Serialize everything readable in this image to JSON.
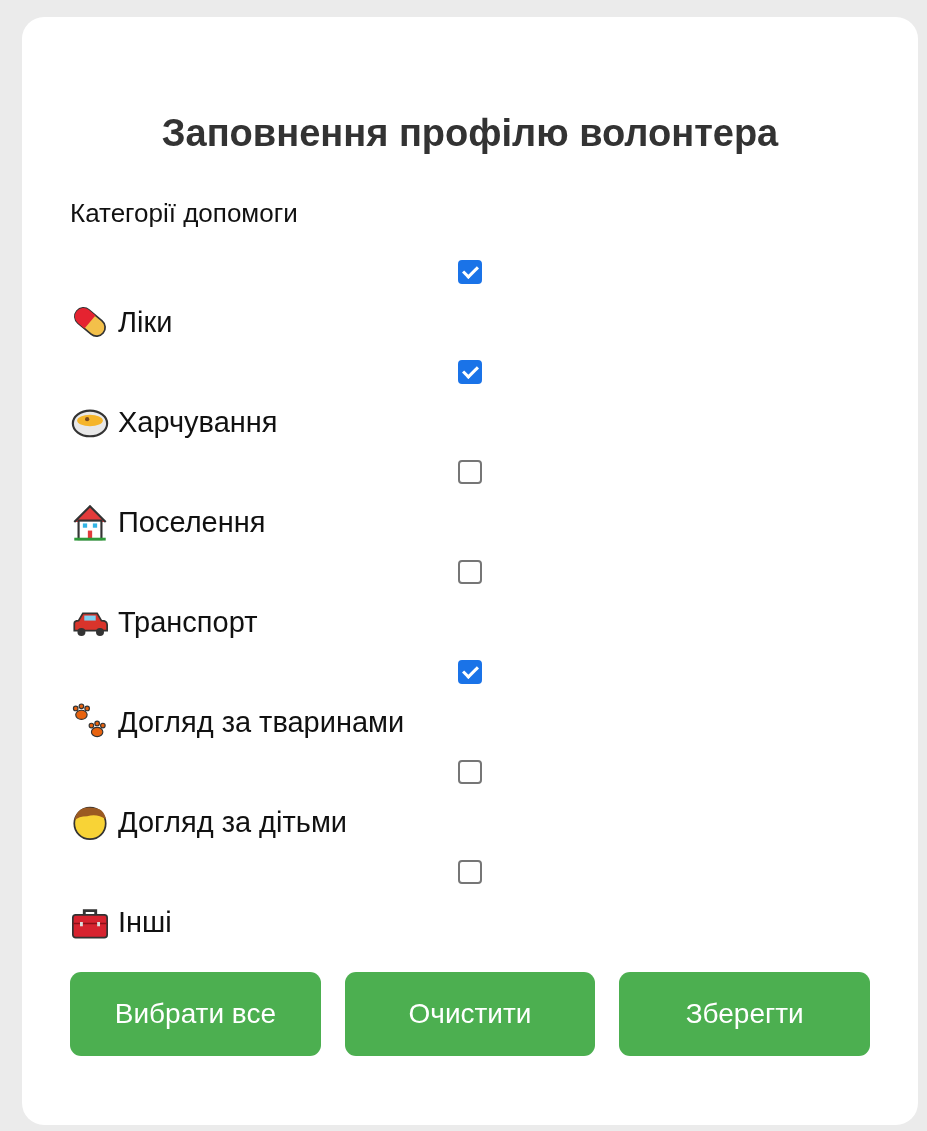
{
  "title": "Заповнення профілю волонтера",
  "section_label": "Категорії допомоги",
  "categories": [
    {
      "label": "Ліки",
      "checked": true
    },
    {
      "label": "Харчування",
      "checked": true
    },
    {
      "label": "Поселення",
      "checked": false
    },
    {
      "label": "Транспорт",
      "checked": false
    },
    {
      "label": "Догляд за тваринами",
      "checked": true
    },
    {
      "label": "Догляд за дітьми",
      "checked": false
    },
    {
      "label": "Інші",
      "checked": false
    }
  ],
  "buttons": [
    "Вибрати все",
    "Очистити",
    "Зберегти"
  ]
}
